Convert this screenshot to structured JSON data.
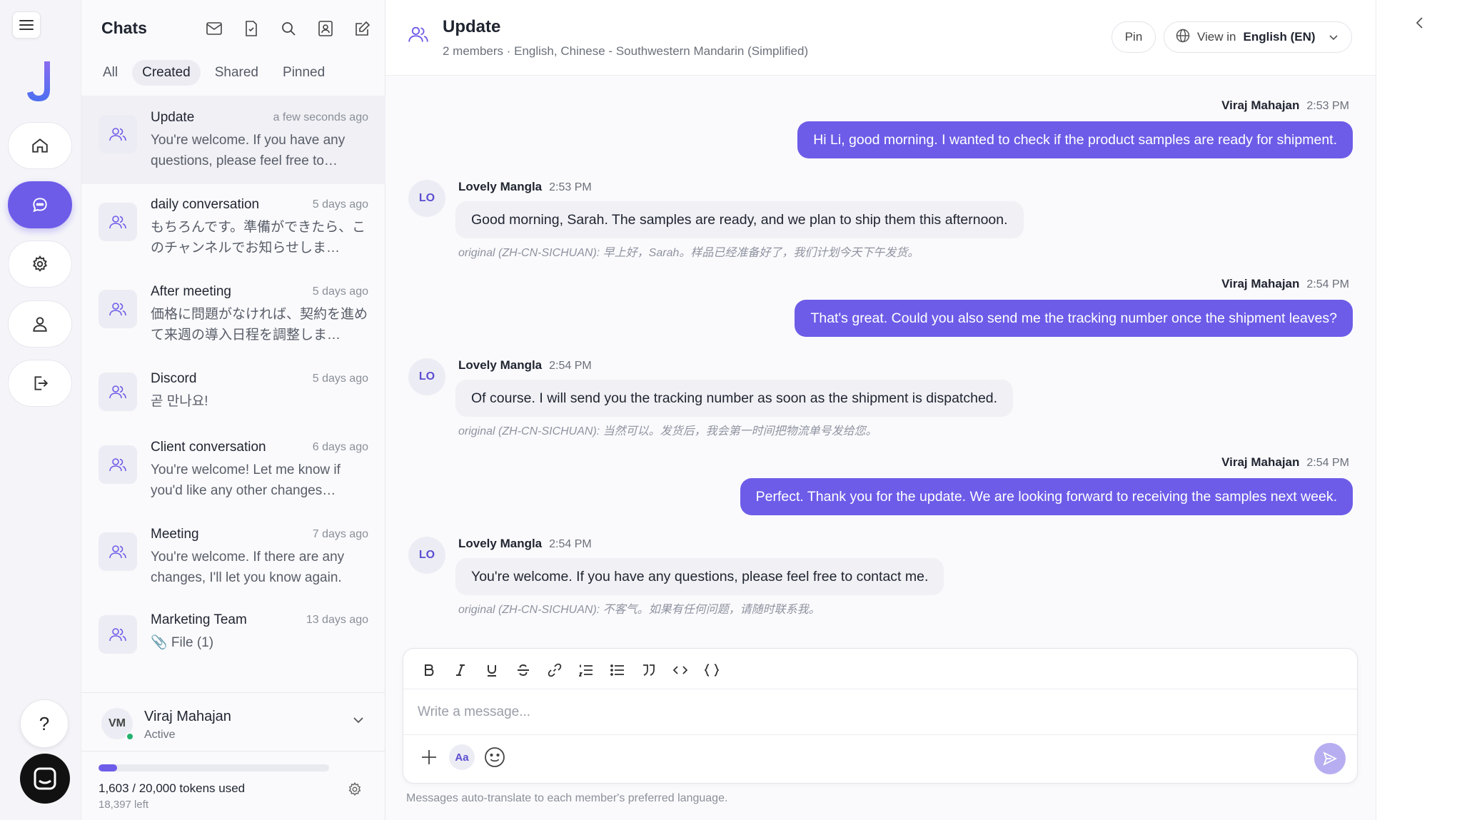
{
  "rail": {
    "menu_icon": "hamburger-icon",
    "logo_letter": "J",
    "nav": [
      "home-icon",
      "chat-icon",
      "settings-icon",
      "user-icon",
      "logout-icon"
    ],
    "help_label": "?",
    "accent": "#6d5ce8"
  },
  "chats": {
    "title": "Chats",
    "actions": [
      "mail-icon",
      "document-icon",
      "search-icon",
      "contacts-icon",
      "compose-icon"
    ],
    "filters": [
      "All",
      "Created",
      "Shared",
      "Pinned"
    ],
    "active_filter": "Created",
    "items": [
      {
        "name": "Update",
        "time": "a few seconds ago",
        "preview": "You're welcome. If you have any questions, please feel free to…"
      },
      {
        "name": "daily conversation",
        "time": "5 days ago",
        "preview": "もちろんです。準備ができたら、このチャンネルでお知らせしま…"
      },
      {
        "name": "After meeting",
        "time": "5 days ago",
        "preview": "価格に問題がなければ、契約を進めて来週の導入日程を調整しま…"
      },
      {
        "name": "Discord",
        "time": "5 days ago",
        "preview": "곧 만나요!"
      },
      {
        "name": "Client conversation",
        "time": "6 days ago",
        "preview": "You're welcome! Let me know if you'd like any other changes…"
      },
      {
        "name": "Meeting",
        "time": "7 days ago",
        "preview": "You're welcome. If there are any changes, I'll let you know again."
      },
      {
        "name": "Marketing Team",
        "time": "13 days ago",
        "preview": "📎 File (1)"
      }
    ]
  },
  "user": {
    "initials": "VM",
    "name": "Viraj Mahajan",
    "status": "Active"
  },
  "tokens": {
    "used_label": "1,603 / 20,000 tokens used",
    "left_label": "18,397 left",
    "used_fraction": 0.08
  },
  "header": {
    "title": "Update",
    "subtitle": "2 members · English, Chinese - Southwestern Mandarin (Simplified)",
    "pin_label": "Pin",
    "view_in_label": "View in",
    "view_lang": "English (EN)"
  },
  "messages": [
    {
      "dir": "out",
      "author": "Viraj Mahajan",
      "time": "2:53 PM",
      "text": "Hi Li, good morning. I wanted to check if the product samples are ready for shipment."
    },
    {
      "dir": "in",
      "initials": "LO",
      "author": "Lovely Mangla",
      "time": "2:53 PM",
      "text": "Good morning, Sarah. The samples are ready, and we plan to ship them this afternoon.",
      "original": "original (ZH-CN-SICHUAN): 早上好，Sarah。样品已经准备好了，我们计划今天下午发货。"
    },
    {
      "dir": "out",
      "author": "Viraj Mahajan",
      "time": "2:54 PM",
      "text": "That's great. Could you also send me the tracking number once the shipment leaves?"
    },
    {
      "dir": "in",
      "initials": "LO",
      "author": "Lovely Mangla",
      "time": "2:54 PM",
      "text": "Of course. I will send you the tracking number as soon as the shipment is dispatched.",
      "original": "original (ZH-CN-SICHUAN): 当然可以。发货后，我会第一时间把物流单号发给您。"
    },
    {
      "dir": "out",
      "author": "Viraj Mahajan",
      "time": "2:54 PM",
      "text": "Perfect. Thank you for the update. We are looking forward to receiving the samples next week."
    },
    {
      "dir": "in",
      "initials": "LO",
      "author": "Lovely Mangla",
      "time": "2:54 PM",
      "text": "You're welcome. If you have any questions, please feel free to contact me.",
      "original": "original (ZH-CN-SICHUAN): 不客气。如果有任何问题，请随时联系我。"
    }
  ],
  "composer": {
    "toolbar": [
      "bold-icon",
      "italic-icon",
      "underline-icon",
      "strikethrough-icon",
      "link-icon",
      "ordered-list-icon",
      "bullet-list-icon",
      "quote-icon",
      "code-icon",
      "code-block-icon"
    ],
    "placeholder": "Write a message...",
    "aa_label": "Aa",
    "hint": "Messages auto-translate to each member's preferred language."
  }
}
